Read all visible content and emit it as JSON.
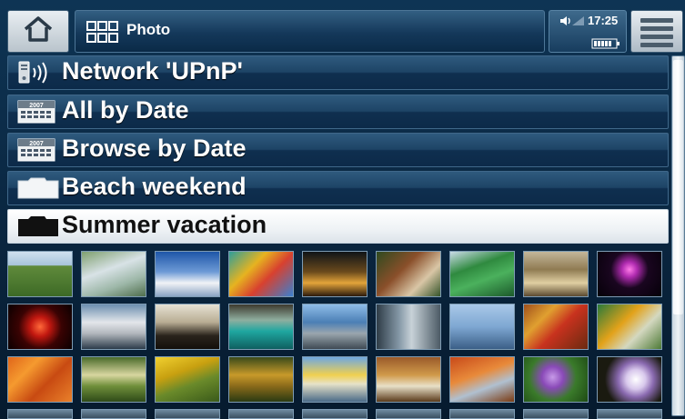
{
  "header": {
    "title": "Photo",
    "time": "17:25",
    "icons": {
      "home": "home-icon",
      "view": "grid-view-icon",
      "volume": "volume-icon",
      "battery": "battery-icon",
      "menu": "menu-icon"
    }
  },
  "list": {
    "items": [
      {
        "label": "Network 'UPnP'",
        "icon": "network-icon",
        "selected": false
      },
      {
        "label": "All by Date",
        "icon": "calendar-icon",
        "selected": false
      },
      {
        "label": "Browse by Date",
        "icon": "calendar-icon",
        "selected": false
      },
      {
        "label": "Beach weekend",
        "icon": "folder-icon",
        "selected": false
      },
      {
        "label": "Summer vacation",
        "icon": "folder-icon",
        "selected": true
      }
    ]
  },
  "thumbnails": {
    "rows": [
      [
        "landscape-hills",
        "waterfall",
        "sky-clouds",
        "playground",
        "night-street",
        "rock-plant",
        "green-structure",
        "chess-pieces",
        "firework-pink"
      ],
      [
        "firework-red",
        "fountain",
        "chess-silhouette",
        "cave-lagoon",
        "city-towers",
        "skyscraper",
        "ferris-wheel",
        "spice-jars",
        "teapot"
      ],
      [
        "orange-leaves",
        "garden-path",
        "yellow-tree",
        "autumn-forest",
        "birch-trees",
        "autumn-park",
        "orange-tree",
        "purple-flower",
        "white-flower"
      ]
    ]
  },
  "calendar_icon_text": "2007"
}
